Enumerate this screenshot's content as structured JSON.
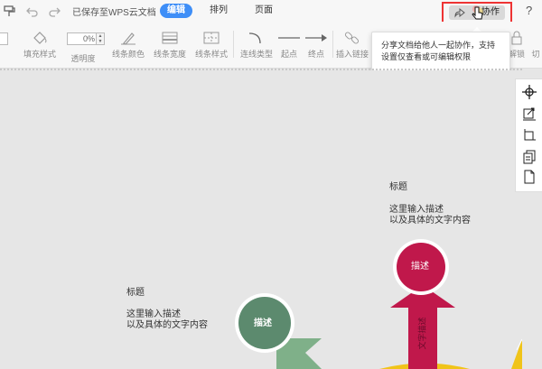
{
  "topbar": {
    "saved_text": "已保存至WPS云文档",
    "tabs": [
      {
        "label": "编辑",
        "active": true
      },
      {
        "label": "排列",
        "active": false
      },
      {
        "label": "页面",
        "active": false
      }
    ],
    "collab_label": "协作",
    "help": "?"
  },
  "toolbar": {
    "opacity_value": "0%",
    "labels": {
      "fill_style": "填充样式",
      "transparency": "透明度",
      "line_color": "线条颜色",
      "line_width": "线条宽度",
      "line_style": "线条样式",
      "connector_type": "连线类型",
      "start_point": "起点",
      "end_point": "终点",
      "insert_link": "插入链接",
      "unlock": "解锁",
      "cut": "切"
    }
  },
  "tooltip": {
    "line1": "分享文档给他人一起协作，支持",
    "line2": "设置仅查看或可编辑权限"
  },
  "canvas": {
    "block_left": {
      "title": "标题",
      "desc1": "这里输入描述",
      "desc2": "以及具体的文字内容",
      "circle_label": "描述"
    },
    "block_right": {
      "title": "标题",
      "desc1": "这里输入描述",
      "desc2": "以及具体的文字内容",
      "circle_label": "描述",
      "arrow_label": "文字描述"
    },
    "colors": {
      "green": "#5c8a6e",
      "green_light": "#7fb089",
      "crimson": "#c0184b",
      "yellow": "#f0c419"
    }
  },
  "right_panel": {
    "icons": [
      "crosshair-icon",
      "resize-icon",
      "crop-icon",
      "copy-icon",
      "page-icon"
    ]
  }
}
